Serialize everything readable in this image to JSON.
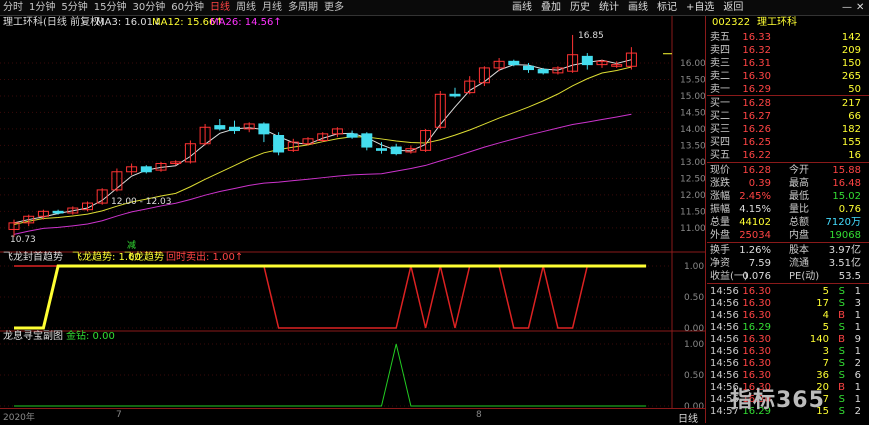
{
  "period_tabs": [
    "分时",
    "1分钟",
    "5分钟",
    "15分钟",
    "30分钟",
    "60分钟",
    "日线",
    "周线",
    "月线",
    "多周期",
    "更多"
  ],
  "active_tab": "日线",
  "toolbar_right": [
    "画线",
    "叠加",
    "历史",
    "统计",
    "画线",
    "标记",
    "+自选",
    "返回"
  ],
  "stock": {
    "code": "002322",
    "name": "理工环科",
    "title": "理工环科(日线 前复权)"
  },
  "indicators": {
    "ma3": "MA3: 16.01↓",
    "ma12": "MA12: 15.66↑",
    "ma26": "MA26: 14.56↑",
    "price_high": "16.85",
    "range_label": "12.00 - 12.03",
    "price_low": "10.73",
    "label_jian": "减"
  },
  "y_axis_main": [
    "16.00",
    "15.50",
    "15.00",
    "14.50",
    "14.00",
    "13.50",
    "13.00",
    "12.50",
    "12.00",
    "11.50",
    "11.00"
  ],
  "panel2": {
    "title": "飞龙封首趋势",
    "v1": "飞龙趋势: 1.00",
    "v2": "飞龙趋势",
    "v3": "回时卖出: 1.00↑",
    "axis": [
      "1.00",
      "0.50",
      "0.00"
    ]
  },
  "panel3": {
    "title": "龙息寻宝副图",
    "v1": "金钻: 0.00",
    "axis": [
      "1.00",
      "0.50",
      "0.00"
    ]
  },
  "bottom_axis": {
    "year": "2020年",
    "m1": "7",
    "m2": "8",
    "right": "日线"
  },
  "orderbook": {
    "sell": [
      {
        "label": "卖五",
        "price": "16.33",
        "vol": "142"
      },
      {
        "label": "卖四",
        "price": "16.32",
        "vol": "209"
      },
      {
        "label": "卖三",
        "price": "16.31",
        "vol": "150"
      },
      {
        "label": "卖二",
        "price": "16.30",
        "vol": "265"
      },
      {
        "label": "卖一",
        "price": "16.29",
        "vol": "50"
      }
    ],
    "buy": [
      {
        "label": "买一",
        "price": "16.28",
        "vol": "217"
      },
      {
        "label": "买二",
        "price": "16.27",
        "vol": "66"
      },
      {
        "label": "买三",
        "price": "16.26",
        "vol": "182"
      },
      {
        "label": "买四",
        "price": "16.25",
        "vol": "155"
      },
      {
        "label": "买五",
        "price": "16.22",
        "vol": "16"
      }
    ]
  },
  "quote": [
    {
      "l1": "现价",
      "v1": "16.28",
      "c1": "red",
      "l2": "今开",
      "v2": "15.88",
      "c2": "red"
    },
    {
      "l1": "涨跌",
      "v1": "0.39",
      "c1": "red",
      "l2": "最高",
      "v2": "16.48",
      "c2": "red"
    },
    {
      "l1": "涨幅",
      "v1": "2.45%",
      "c1": "red",
      "l2": "最低",
      "v2": "15.02",
      "c2": "green"
    },
    {
      "l1": "振幅",
      "v1": "4.15%",
      "c1": "white",
      "l2": "量比",
      "v2": "0.76",
      "c2": "yellow"
    },
    {
      "l1": "总量",
      "v1": "44102",
      "c1": "yellow",
      "l2": "总额",
      "v2": "7120万",
      "c2": "cyan"
    },
    {
      "l1": "外盘",
      "v1": "25034",
      "c1": "red",
      "l2": "内盘",
      "v2": "19068",
      "c2": "green"
    }
  ],
  "quote2": [
    {
      "l1": "换手",
      "v1": "1.26%",
      "l2": "股本",
      "v2": "3.97亿"
    },
    {
      "l1": "净资",
      "v1": "7.59",
      "l2": "流通",
      "v2": "3.51亿"
    },
    {
      "l1": "收益(一)",
      "v1": "0.076",
      "l2": "PE(动)",
      "v2": "53.5"
    }
  ],
  "ticks": [
    {
      "t": "14:56",
      "p": "16.30",
      "v": "5",
      "s": "S",
      "n": "1"
    },
    {
      "t": "14:56",
      "p": "16.30",
      "v": "17",
      "s": "S",
      "n": "3"
    },
    {
      "t": "14:56",
      "p": "16.30",
      "v": "4",
      "s": "B",
      "n": "1"
    },
    {
      "t": "14:56",
      "p": "16.29",
      "v": "5",
      "s": "S",
      "n": "1"
    },
    {
      "t": "14:56",
      "p": "16.30",
      "v": "140",
      "s": "B",
      "n": "9"
    },
    {
      "t": "14:56",
      "p": "16.30",
      "v": "3",
      "s": "S",
      "n": "1"
    },
    {
      "t": "14:56",
      "p": "16.30",
      "v": "7",
      "s": "S",
      "n": "2"
    },
    {
      "t": "14:56",
      "p": "16.30",
      "v": "36",
      "s": "S",
      "n": "6"
    },
    {
      "t": "14:56",
      "p": "16.30",
      "v": "20",
      "s": "B",
      "n": "1"
    },
    {
      "t": "14:56",
      "p": "16.30",
      "v": "7",
      "s": "S",
      "n": "1"
    },
    {
      "t": "14:57",
      "p": "16.29",
      "v": "15",
      "s": "S",
      "n": "2"
    }
  ],
  "watermark": "指标365",
  "candles": [
    {
      "o": 10.95,
      "c": 11.15,
      "h": 11.25,
      "l": 10.73
    },
    {
      "o": 11.15,
      "c": 11.35,
      "h": 11.4,
      "l": 11.05
    },
    {
      "o": 11.35,
      "c": 11.5,
      "h": 11.55,
      "l": 11.25
    },
    {
      "o": 11.5,
      "c": 11.45,
      "h": 11.55,
      "l": 11.4
    },
    {
      "o": 11.45,
      "c": 11.6,
      "h": 11.65,
      "l": 11.4
    },
    {
      "o": 11.55,
      "c": 11.75,
      "h": 11.8,
      "l": 11.5
    },
    {
      "o": 11.75,
      "c": 12.15,
      "h": 12.2,
      "l": 11.7
    },
    {
      "o": 12.15,
      "c": 12.7,
      "h": 12.8,
      "l": 12.1
    },
    {
      "o": 12.7,
      "c": 12.85,
      "h": 12.95,
      "l": 12.6
    },
    {
      "o": 12.85,
      "c": 12.7,
      "h": 12.9,
      "l": 12.65
    },
    {
      "o": 12.75,
      "c": 12.95,
      "h": 13.0,
      "l": 12.7
    },
    {
      "o": 12.95,
      "c": 13.0,
      "h": 13.05,
      "l": 12.9
    },
    {
      "o": 13.0,
      "c": 13.55,
      "h": 13.65,
      "l": 12.95
    },
    {
      "o": 13.55,
      "c": 14.05,
      "h": 14.15,
      "l": 13.5
    },
    {
      "o": 14.1,
      "c": 14.0,
      "h": 14.3,
      "l": 13.95
    },
    {
      "o": 14.05,
      "c": 13.95,
      "h": 14.25,
      "l": 13.85
    },
    {
      "o": 14.0,
      "c": 14.15,
      "h": 14.2,
      "l": 13.9
    },
    {
      "o": 14.15,
      "c": 13.85,
      "h": 14.2,
      "l": 13.6
    },
    {
      "o": 13.8,
      "c": 13.3,
      "h": 13.9,
      "l": 13.2
    },
    {
      "o": 13.35,
      "c": 13.6,
      "h": 13.7,
      "l": 13.3
    },
    {
      "o": 13.55,
      "c": 13.7,
      "h": 13.75,
      "l": 13.5
    },
    {
      "o": 13.65,
      "c": 13.85,
      "h": 13.9,
      "l": 13.6
    },
    {
      "o": 13.85,
      "c": 14.0,
      "h": 14.05,
      "l": 13.75
    },
    {
      "o": 13.85,
      "c": 13.75,
      "h": 13.95,
      "l": 13.7
    },
    {
      "o": 13.85,
      "c": 13.45,
      "h": 13.9,
      "l": 13.35
    },
    {
      "o": 13.4,
      "c": 13.35,
      "h": 13.6,
      "l": 13.25
    },
    {
      "o": 13.45,
      "c": 13.25,
      "h": 13.55,
      "l": 13.2
    },
    {
      "o": 13.3,
      "c": 13.4,
      "h": 13.5,
      "l": 13.25
    },
    {
      "o": 13.35,
      "c": 13.95,
      "h": 14.0,
      "l": 13.3
    },
    {
      "o": 14.05,
      "c": 15.05,
      "h": 15.15,
      "l": 14.0
    },
    {
      "o": 15.05,
      "c": 15.0,
      "h": 15.25,
      "l": 14.95
    },
    {
      "o": 15.1,
      "c": 15.45,
      "h": 15.6,
      "l": 15.05
    },
    {
      "o": 15.4,
      "c": 15.85,
      "h": 15.9,
      "l": 15.3
    },
    {
      "o": 15.85,
      "c": 16.05,
      "h": 16.15,
      "l": 15.75
    },
    {
      "o": 16.05,
      "c": 15.95,
      "h": 16.1,
      "l": 15.9
    },
    {
      "o": 15.9,
      "c": 15.8,
      "h": 16.0,
      "l": 15.7
    },
    {
      "o": 15.8,
      "c": 15.7,
      "h": 15.85,
      "l": 15.65
    },
    {
      "o": 15.7,
      "c": 15.85,
      "h": 15.9,
      "l": 15.65
    },
    {
      "o": 15.75,
      "c": 16.25,
      "h": 16.85,
      "l": 15.7
    },
    {
      "o": 16.2,
      "c": 15.95,
      "h": 16.3,
      "l": 15.8
    },
    {
      "o": 15.95,
      "c": 16.05,
      "h": 16.1,
      "l": 15.85
    },
    {
      "o": 15.9,
      "c": 15.95,
      "h": 16.05,
      "l": 15.85
    },
    {
      "o": 15.9,
      "c": 16.3,
      "h": 16.48,
      "l": 15.8
    }
  ],
  "signal_trend": [
    0,
    0,
    0,
    1,
    1,
    1,
    1,
    1,
    1,
    1,
    1,
    1,
    1,
    1,
    1,
    1,
    1,
    1,
    1,
    1,
    1,
    1,
    1,
    1,
    1,
    1,
    1,
    1,
    1,
    1,
    1,
    1,
    1,
    1,
    1,
    1,
    1,
    1,
    1,
    1,
    1,
    1,
    1,
    1
  ],
  "signal_sell": [
    1,
    1,
    1,
    1,
    1,
    1,
    1,
    1,
    1,
    1,
    1,
    1,
    1,
    1,
    1,
    1,
    1,
    1,
    0,
    0,
    0,
    0,
    0,
    0,
    0,
    0,
    0,
    1,
    0,
    1,
    0,
    1,
    1,
    1,
    0,
    0,
    1,
    0,
    0,
    1,
    1,
    1,
    1,
    1
  ],
  "signal_gold": [
    0,
    0,
    0,
    0,
    0,
    0,
    0,
    0,
    0,
    0,
    0,
    0,
    0,
    0,
    0,
    0,
    0,
    0,
    0,
    0,
    0,
    0,
    0,
    0,
    0,
    0,
    1,
    0,
    0,
    0,
    0,
    0,
    0,
    0,
    0,
    0,
    0,
    0,
    0,
    0,
    0,
    0,
    0,
    0
  ]
}
